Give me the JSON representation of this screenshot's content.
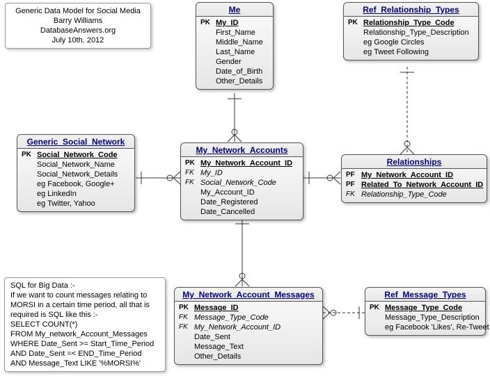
{
  "meta_box": {
    "line1": "Generic Data Model for Social Media",
    "line2": "Barry Williams",
    "line3": "DatabaseAnswers.org",
    "line4": "July 10th. 2012"
  },
  "sql_box": {
    "line1": "SQL for Big Data :-",
    "line2": "If we want to count messages relating to",
    "line3": "MORSI in a certain time period, all that is",
    "line4": "required is SQL like this :-",
    "line5": "  SELECT COUNT(*)",
    "line6": "  FROM My_network_Account_Messages",
    "line7": "WHERE Date_Sent >= Start_Time_Period",
    "line8": "  AND Date_Sent =< END_Time_Period",
    "line9": "  AND Message_Text LIKE '%MORSI%'"
  },
  "entities": {
    "me": {
      "title": "Me",
      "fields": [
        {
          "key": "PK",
          "name": "My_ID",
          "cls": "pk"
        },
        {
          "key": "",
          "name": "First_Name",
          "cls": ""
        },
        {
          "key": "",
          "name": "Middle_Name",
          "cls": ""
        },
        {
          "key": "",
          "name": "Last_Name",
          "cls": ""
        },
        {
          "key": "",
          "name": "Gender",
          "cls": ""
        },
        {
          "key": "",
          "name": "Date_of_Birth",
          "cls": ""
        },
        {
          "key": "",
          "name": "Other_Details",
          "cls": ""
        }
      ]
    },
    "ref_rel_types": {
      "title": "Ref_Relationship_Types",
      "fields": [
        {
          "key": "PK",
          "name": "Relationship_Type_Code",
          "cls": "pk"
        },
        {
          "key": "",
          "name": "Relationship_Type_Description",
          "cls": ""
        },
        {
          "key": "",
          "name": "eg Google Circles",
          "cls": ""
        },
        {
          "key": "",
          "name": "eg Tweet Following",
          "cls": ""
        }
      ]
    },
    "gsn": {
      "title": "Generic_Social_Network",
      "fields": [
        {
          "key": "PK",
          "name": "Social_Network_Code",
          "cls": "pk"
        },
        {
          "key": "",
          "name": "Social_Network_Name",
          "cls": ""
        },
        {
          "key": "",
          "name": "Social_Network_Details",
          "cls": ""
        },
        {
          "key": "",
          "name": "eg Facebook, Google+",
          "cls": ""
        },
        {
          "key": "",
          "name": "eg LinkedIn",
          "cls": ""
        },
        {
          "key": "",
          "name": "eg Twitter, Yahoo",
          "cls": ""
        }
      ]
    },
    "mna": {
      "title": "My_Network_Accounts",
      "fields": [
        {
          "key": "PK",
          "name": "My_Network_Account_ID",
          "cls": "pk"
        },
        {
          "key": "FK",
          "name": "My_ID",
          "cls": "fk"
        },
        {
          "key": "FK",
          "name": "Social_Network_Code",
          "cls": "fk"
        },
        {
          "key": "",
          "name": "My_Account_ID",
          "cls": ""
        },
        {
          "key": "",
          "name": "Date_Registered",
          "cls": ""
        },
        {
          "key": "",
          "name": "Date_Cancelled",
          "cls": ""
        }
      ]
    },
    "relationships": {
      "title": "Relationships",
      "fields": [
        {
          "key": "PF",
          "name": "My_Network_Account_ID",
          "cls": "pf"
        },
        {
          "key": "PF",
          "name": "Related_To_Network_Account_ID",
          "cls": "pf"
        },
        {
          "key": "FK",
          "name": "Relationship_Type_Code",
          "cls": "fk"
        }
      ]
    },
    "mnam": {
      "title": "My_Network_Account_Messages",
      "fields": [
        {
          "key": "PK",
          "name": "Message_ID",
          "cls": "pk"
        },
        {
          "key": "FK",
          "name": "Message_Type_Code",
          "cls": "fk"
        },
        {
          "key": "FK",
          "name": "My_Network_Account_ID",
          "cls": "fk"
        },
        {
          "key": "",
          "name": "Date_Sent",
          "cls": ""
        },
        {
          "key": "",
          "name": "Message_Text",
          "cls": ""
        },
        {
          "key": "",
          "name": "Other_Details",
          "cls": ""
        }
      ]
    },
    "ref_msg_types": {
      "title": "Ref_Message_Types",
      "fields": [
        {
          "key": "PK",
          "name": "Message_Type_Code",
          "cls": "pk"
        },
        {
          "key": "",
          "name": "Message_Type_Description",
          "cls": ""
        },
        {
          "key": "",
          "name": "eg Facebook 'Likes', Re-Tweet",
          "cls": ""
        }
      ]
    }
  }
}
